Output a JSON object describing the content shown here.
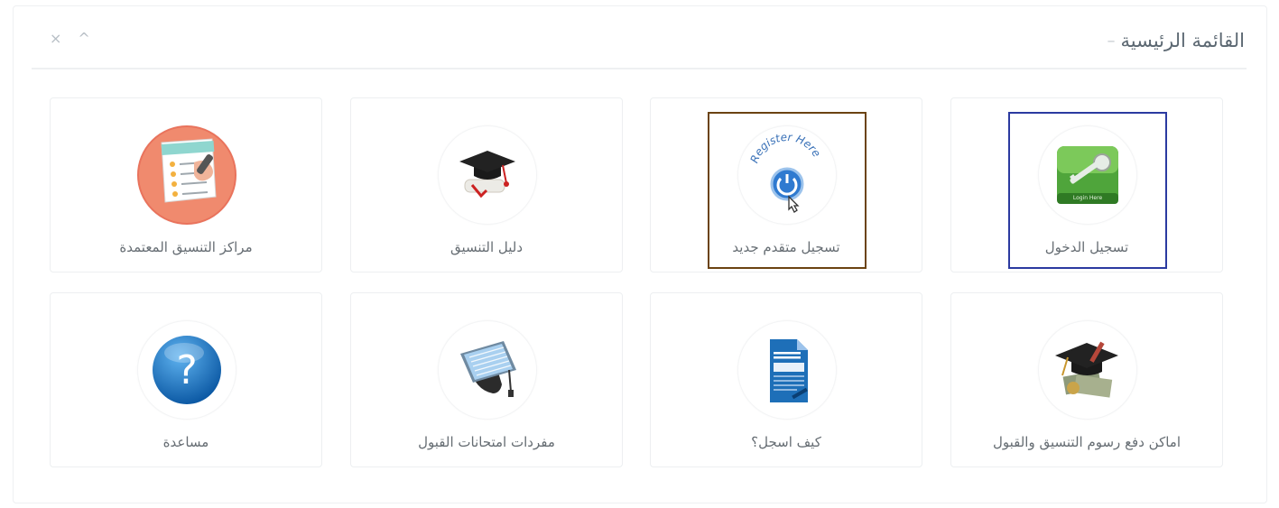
{
  "panel": {
    "title": "القائمة الرئيسية",
    "title_prefix": "–",
    "tools": {
      "collapse": "^",
      "close": "×"
    }
  },
  "cards": [
    {
      "label": "تسجيل الدخول",
      "icon": "login-key-icon"
    },
    {
      "label": "تسجيل متقدم جديد",
      "icon": "register-here-icon",
      "icon_text": "Register Here"
    },
    {
      "label": "دليل التنسيق",
      "icon": "graduation-cap-icon"
    },
    {
      "label": "مراكز التنسيق المعتمدة",
      "icon": "checklist-icon"
    },
    {
      "label": "اماكن دفع رسوم التنسيق والقبول",
      "icon": "cap-money-icon"
    },
    {
      "label": "كيف اسجل؟",
      "icon": "document-icon"
    },
    {
      "label": "مفردات امتحانات القبول",
      "icon": "tablet-cap-icon"
    },
    {
      "label": "مساعدة",
      "icon": "help-icon",
      "icon_text": "?"
    }
  ],
  "colors": {
    "blue_highlight": "#2b3aa0",
    "brown_highlight": "#6b4312"
  }
}
